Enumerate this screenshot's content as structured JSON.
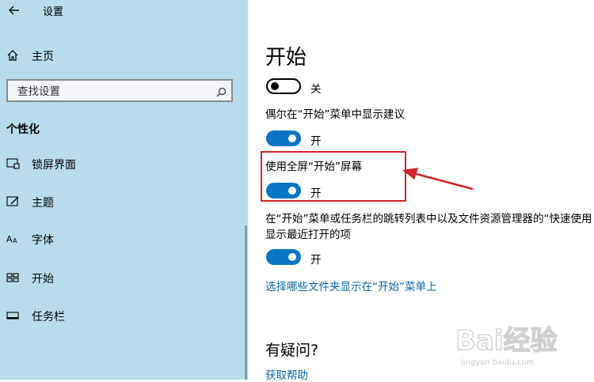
{
  "window": {
    "title": "设置"
  },
  "sidebar": {
    "home_label": "主页",
    "search_placeholder": "查找设置",
    "section_header": "个性化",
    "items": [
      {
        "label": "锁屏界面",
        "icon": "lock-screen-icon"
      },
      {
        "label": "主题",
        "icon": "theme-icon"
      },
      {
        "label": "字体",
        "icon": "font-icon"
      },
      {
        "label": "开始",
        "icon": "start-icon"
      },
      {
        "label": "任务栏",
        "icon": "taskbar-icon"
      }
    ]
  },
  "main": {
    "title": "开始",
    "top_toggle": {
      "state": "关",
      "on": false
    },
    "options": [
      {
        "label": "偶尔在“开始”菜单中显示建议",
        "state": "开",
        "on": true
      },
      {
        "label": "使用全屏“开始”屏幕",
        "state": "开",
        "on": true
      },
      {
        "label_line1": "在“开始”菜单或任务栏的跳转列表中以及文件资源管理器的“快速使用",
        "label_line2": "显示最近打开的项",
        "state": "开",
        "on": true
      }
    ],
    "folders_link": "选择哪些文件夹显示在“开始”菜单上",
    "help_header": "有疑问?",
    "help_link": "获取帮助"
  },
  "watermark": {
    "text": "Bai经验",
    "sub": "jingyan.baidu.com"
  },
  "colors": {
    "sidebar_bg": "#b8dcec",
    "accent": "#0a74c4",
    "highlight": "#d6242a"
  }
}
